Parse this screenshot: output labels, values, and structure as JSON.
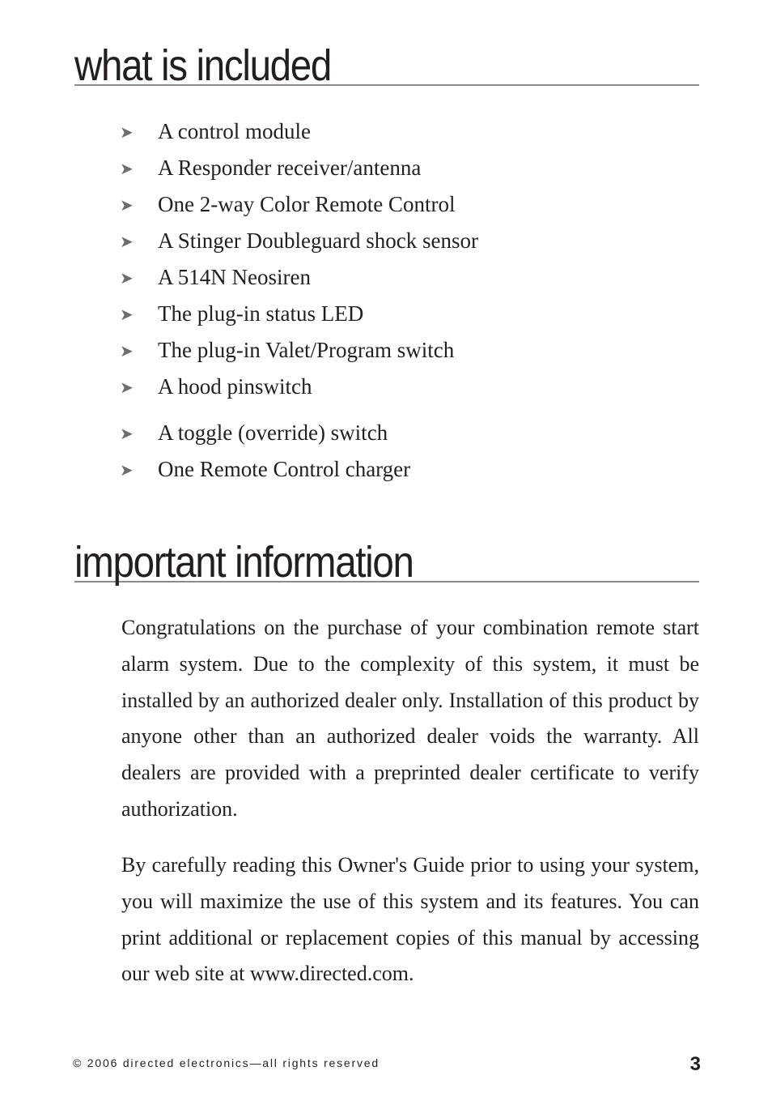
{
  "sections": {
    "included": {
      "heading": "what is included",
      "items": [
        "A control module",
        "A Responder receiver/antenna",
        "One 2-way Color Remote Control",
        "A Stinger Doubleguard shock sensor",
        "A 514N Neosiren",
        "The plug-in status LED",
        "The plug-in Valet/Program switch",
        "A hood pinswitch",
        "A toggle (override) switch",
        "One Remote Control charger"
      ],
      "bullet_icon": "arrowhead-icon",
      "bullet_glyph": "➤"
    },
    "important": {
      "heading": "important information",
      "paragraphs": [
        "Congratulations on the purchase of your combination remote start alarm system. Due to the complexity of this system, it must be installed by an authorized dealer only. Installation of this product by anyone other than an authorized dealer voids the warranty. All dealers are provided with a preprinted dealer certifi­cate to verify authorization.",
        "By carefully reading this Owner's Guide prior to using your system, you will maximize the use of this system and its features. You can print additional or replacement copies of this manual by accessing our web site at www.directed.com."
      ]
    }
  },
  "footer": {
    "copyright": "© 2006 directed electronics—all rights reserved",
    "page_number": "3"
  }
}
